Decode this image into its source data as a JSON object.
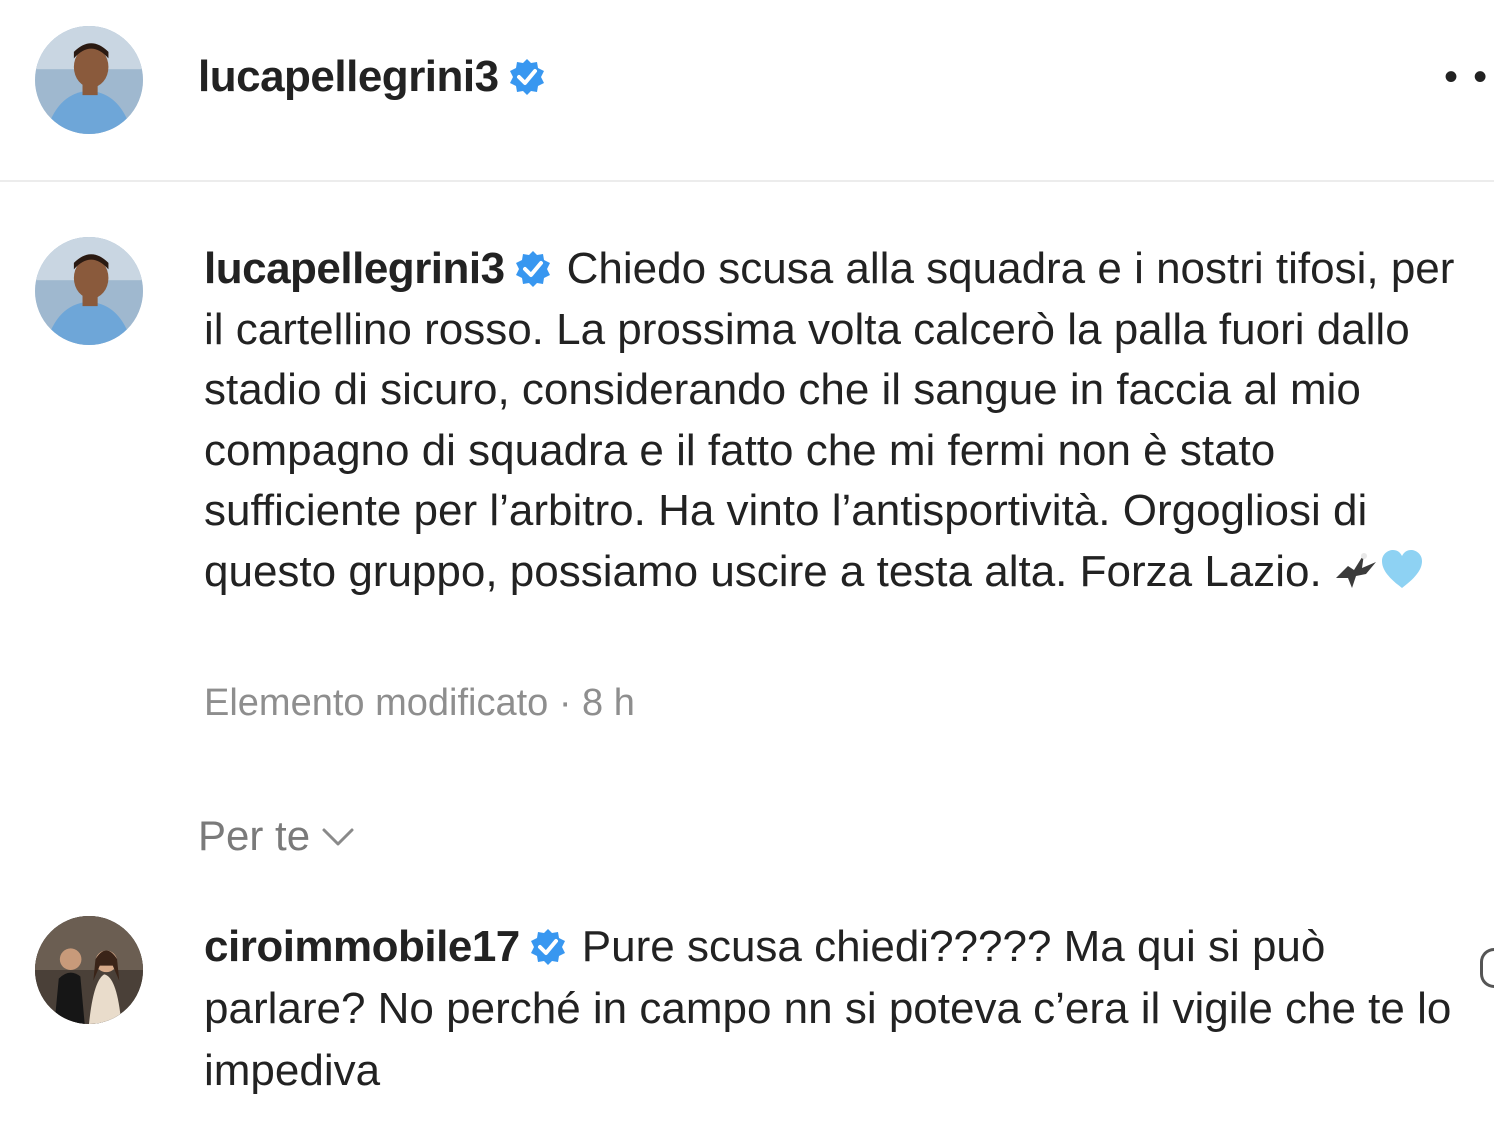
{
  "header": {
    "username": "lucapellegrini3",
    "verified_icon": "verified-badge-icon",
    "more_icon": "more-options-icon",
    "more_label": "• • •"
  },
  "caption": {
    "username": "lucapellegrini3",
    "text": "Chiedo scusa alla squadra e i nostri tifosi, per il cartellino rosso. La prossima volta calcerò la palla fuori dallo stadio di sicuro, considerando che il sangue in faccia al mio compagno di squadra e il fatto che mi fermi non è stato sufficiente per l’arbitro. Ha vinto l’antisportività. Orgogliosi di questo gruppo, possiamo uscire a testa alta. Forza Lazio.",
    "emojis": [
      "eagle-emoji",
      "light-blue-heart-emoji"
    ],
    "meta": "Elemento modificato · 8 h"
  },
  "sort": {
    "label": "Per te",
    "icon": "chevron-down-icon"
  },
  "comment": {
    "username": "ciroimmobile17",
    "text": "Pure scusa chiedi????? Ma qui si può parlare? No perché in campo nn si poteva c’era il vigile che te lo impediva"
  },
  "colors": {
    "verified": "#3897f0",
    "text": "#222222",
    "muted": "#8e8e8e",
    "divider": "#ececec"
  }
}
